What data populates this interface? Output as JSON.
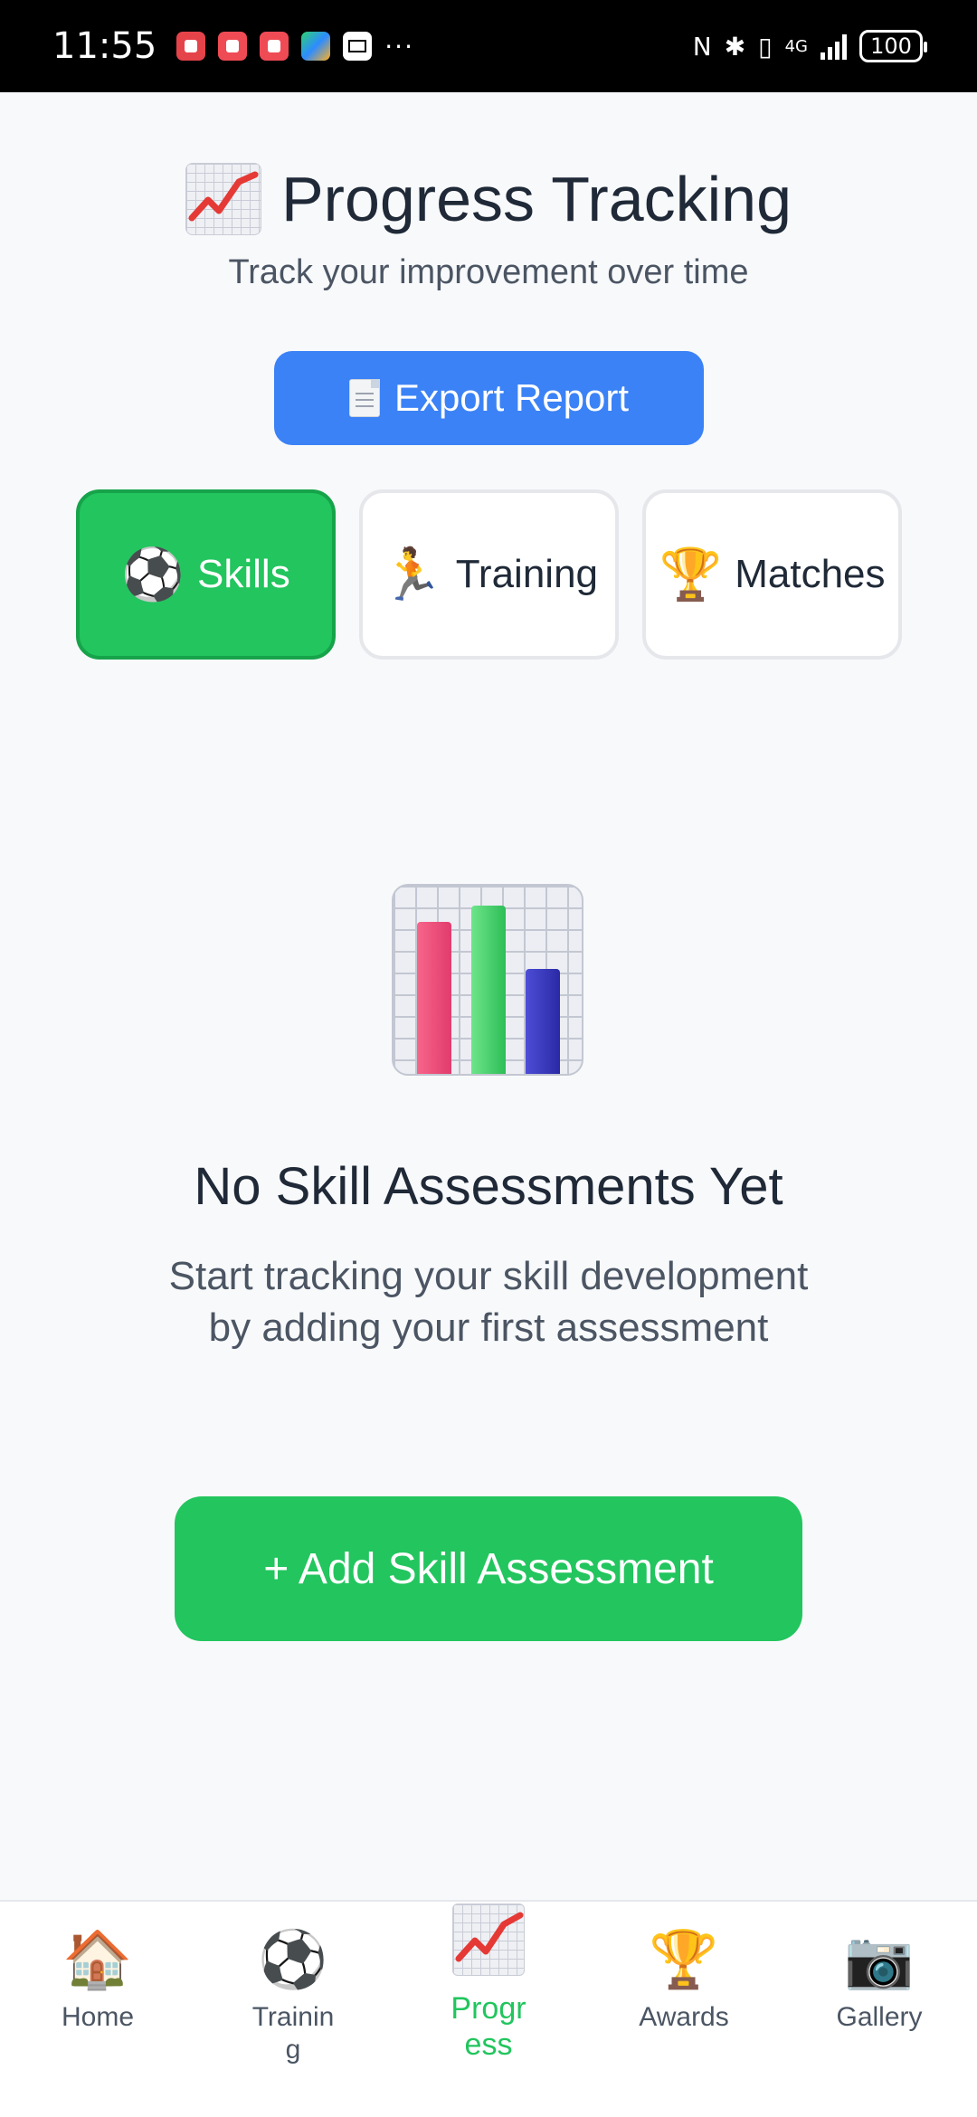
{
  "status_bar": {
    "time": "11:55",
    "more": "···",
    "network": "4G",
    "battery": "100"
  },
  "header": {
    "title": "Progress Tracking",
    "subtitle": "Track your improvement over time"
  },
  "export_button": {
    "label": "Export Report",
    "icon": "document-icon"
  },
  "tabs": [
    {
      "label": "Skills",
      "icon": "⚽",
      "active": true
    },
    {
      "label": "Training",
      "icon": "🏃",
      "active": false
    },
    {
      "label": "Matches",
      "icon": "🏆",
      "active": false
    }
  ],
  "empty_state": {
    "title": "No Skill Assessments Yet",
    "text": "Start tracking your skill development by adding your first assessment",
    "button": "+ Add Skill Assessment"
  },
  "bottom_nav": [
    {
      "label": "Home",
      "icon": "🏠",
      "active": false
    },
    {
      "label": "Training",
      "icon": "⚽",
      "active": false
    },
    {
      "label": "Progress",
      "icon": "chart-increasing-icon",
      "active": true
    },
    {
      "label": "Awards",
      "icon": "🏆",
      "active": false
    },
    {
      "label": "Gallery",
      "icon": "📷",
      "active": false
    }
  ],
  "colors": {
    "primary_green": "#22c55e",
    "export_blue": "#3b82f6",
    "background": "#f8f9fb"
  }
}
